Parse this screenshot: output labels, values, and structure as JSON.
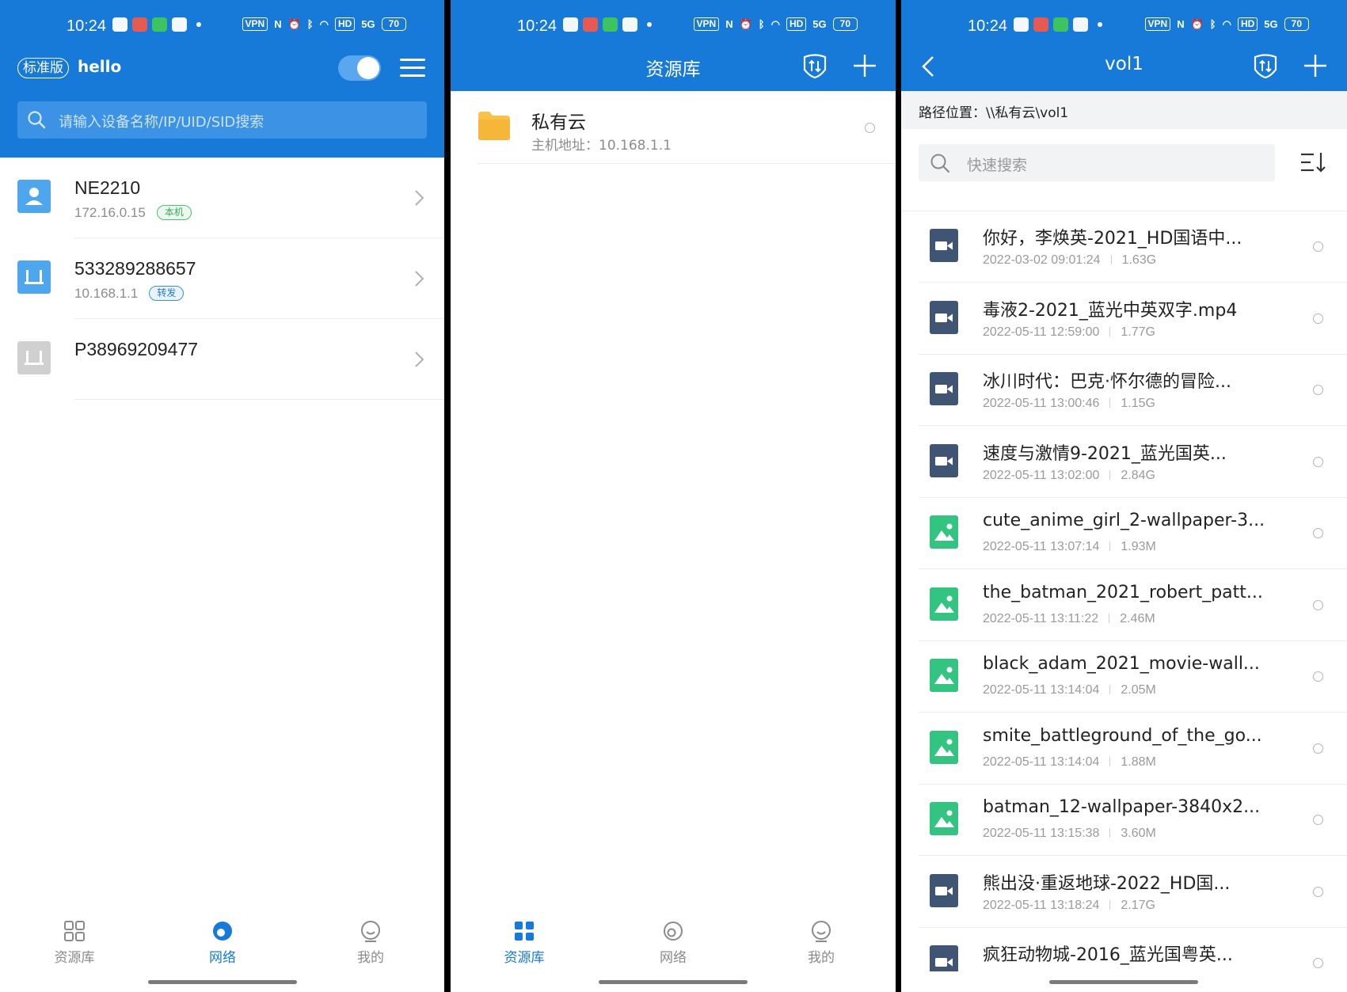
{
  "status": {
    "time": "10:24",
    "vpn": "VPN",
    "hd": "HD",
    "signal": "5G",
    "battery": "70"
  },
  "colors": {
    "primary": "#1779d8",
    "video_icon": "#3f5573",
    "image_icon": "#33c481",
    "folder": "#f8c247"
  },
  "network": {
    "edition": "标准版",
    "username": "hello",
    "search_placeholder": "请输入设备名称/IP/UID/SID搜索",
    "devices": [
      {
        "name": "NE2210",
        "ip": "172.16.0.15",
        "tag": "本机",
        "tag_style": "green",
        "icon": "user-icon"
      },
      {
        "name": "533289288657",
        "ip": "10.168.1.1",
        "tag": "转发",
        "tag_style": "blue",
        "icon": "router-icon"
      },
      {
        "name": "P38969209477",
        "ip": "",
        "tag": "",
        "tag_style": "",
        "icon": "router-offline-icon"
      }
    ]
  },
  "library": {
    "title": "资源库",
    "folders": [
      {
        "name": "私有云",
        "host_label": "主机地址：",
        "host": "10.168.1.1"
      }
    ]
  },
  "vol": {
    "title": "vol1",
    "path_label": "路径位置：",
    "path": "\\\\私有云\\vol1",
    "search_placeholder": "快速搜索",
    "files": [
      {
        "name": "你好，李焕英-2021_HD国语中...",
        "date": "2022-03-02 09:01:24",
        "size": "1.63G",
        "type": "video"
      },
      {
        "name": "毒液2-2021_蓝光中英双字.mp4",
        "date": "2022-05-11 12:59:00",
        "size": "1.77G",
        "type": "video"
      },
      {
        "name": "冰川时代：巴克·怀尔德的冒险...",
        "date": "2022-05-11 13:00:46",
        "size": "1.15G",
        "type": "video"
      },
      {
        "name": "速度与激情9-2021_蓝光国英...",
        "date": "2022-05-11 13:02:00",
        "size": "2.84G",
        "type": "video"
      },
      {
        "name": "cute_anime_girl_2-wallpaper-3...",
        "date": "2022-05-11 13:07:14",
        "size": "1.93M",
        "type": "image"
      },
      {
        "name": "the_batman_2021_robert_patt...",
        "date": "2022-05-11 13:11:22",
        "size": "2.46M",
        "type": "image"
      },
      {
        "name": "black_adam_2021_movie-wall...",
        "date": "2022-05-11 13:14:04",
        "size": "2.05M",
        "type": "image"
      },
      {
        "name": "smite_battleground_of_the_go...",
        "date": "2022-05-11 13:14:04",
        "size": "1.88M",
        "type": "image"
      },
      {
        "name": "batman_12-wallpaper-3840x2...",
        "date": "2022-05-11 13:15:38",
        "size": "3.60M",
        "type": "image"
      },
      {
        "name": "熊出没·重返地球-2022_HD国...",
        "date": "2022-05-11 13:18:24",
        "size": "2.17G",
        "type": "video"
      },
      {
        "name": "疯狂动物城-2016_蓝光国粤英...",
        "date": "",
        "size": "",
        "type": "video"
      }
    ]
  },
  "nav": {
    "library": "资源库",
    "network": "网络",
    "mine": "我的"
  }
}
